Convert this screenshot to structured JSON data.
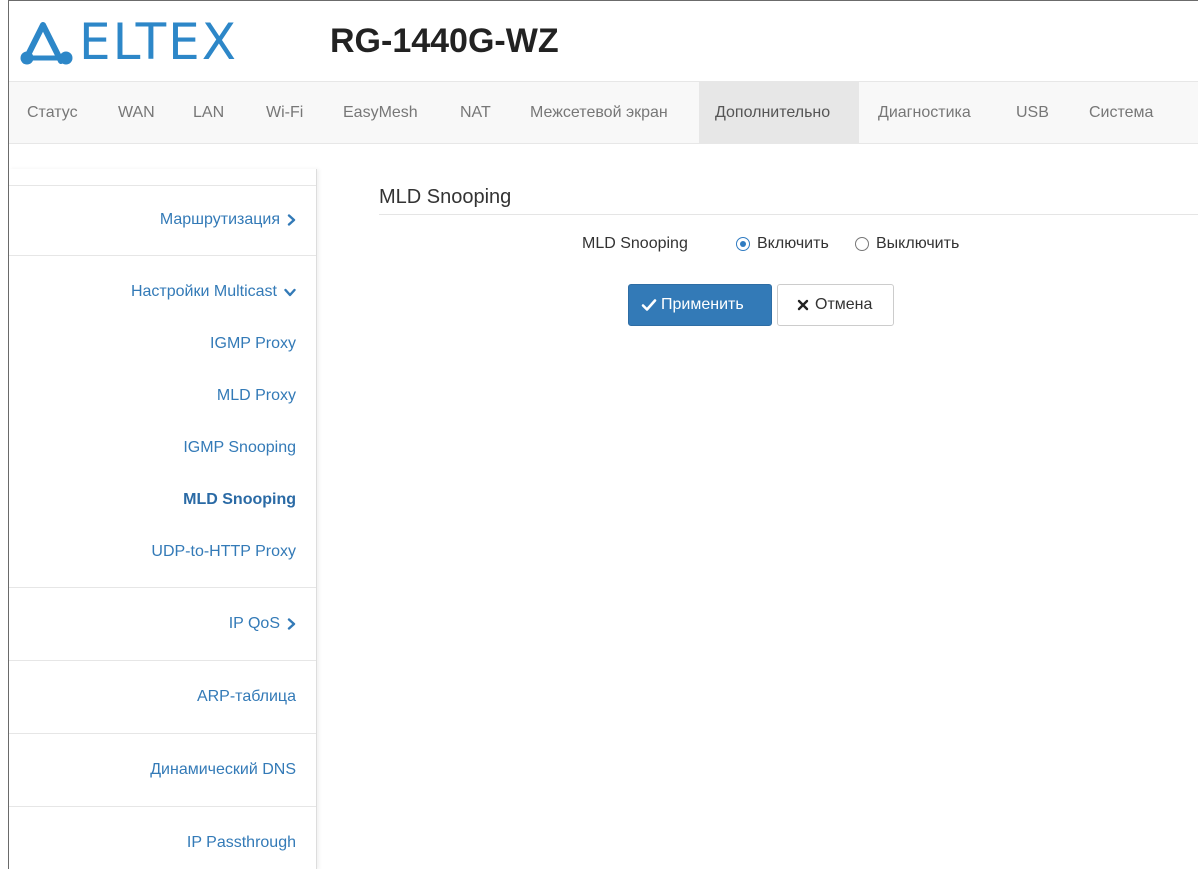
{
  "brand": {
    "logo_text": "ELTEX",
    "model": "RG-1440G-WZ"
  },
  "nav": {
    "items": [
      {
        "label": "Статус"
      },
      {
        "label": "WAN"
      },
      {
        "label": "LAN"
      },
      {
        "label": "Wi-Fi"
      },
      {
        "label": "EasyMesh"
      },
      {
        "label": "NAT"
      },
      {
        "label": "Межсетевой экран"
      },
      {
        "label": "Дополнительно"
      },
      {
        "label": "Диагностика"
      },
      {
        "label": "USB"
      },
      {
        "label": "Система"
      }
    ],
    "active": "Дополнительно"
  },
  "sidebar": {
    "routing": "Маршрутизация",
    "multicast": "Настройки Multicast",
    "multicast_items": [
      {
        "label": "IGMP Proxy"
      },
      {
        "label": "MLD Proxy"
      },
      {
        "label": "IGMP Snooping"
      },
      {
        "label": "MLD Snooping"
      },
      {
        "label": "UDP-to-HTTP Proxy"
      }
    ],
    "active_item": "MLD Snooping",
    "ipqos": "IP QoS",
    "arp": "ARP-таблица",
    "ddns": "Динамический DNS",
    "passthrough": "IP Passthrough"
  },
  "main": {
    "title": "MLD Snooping",
    "field_label": "MLD Snooping",
    "options": {
      "enable": "Включить",
      "disable": "Выключить"
    },
    "selected": "enable",
    "apply_label": "Применить",
    "cancel_label": "Отмена"
  },
  "colors": {
    "accent": "#337ab7",
    "logo": "#2d87c8",
    "nav_active_bg": "#e7e7e7"
  },
  "icons": {
    "chevron_right": "chevron-right-icon",
    "chevron_down": "chevron-down-icon",
    "check": "check-icon",
    "close": "close-icon"
  }
}
